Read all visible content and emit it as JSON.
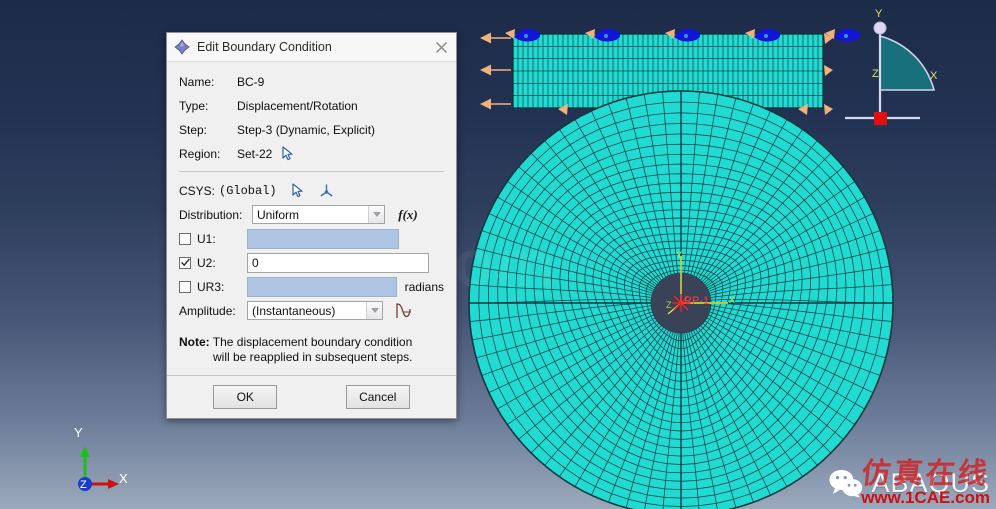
{
  "viewport": {
    "background_top_color": "#1c2b47",
    "background_bottom_color": "#9ba9bd",
    "mesh_fill_color": "#21dbd2",
    "mesh_edge_color": "#14494f",
    "bc_arrow_color": "#f0b27a",
    "bc_marker_color": "#1414d8",
    "watermark_center": "1CAE.com",
    "reference_point_label": "RP-1",
    "rp_axis_y_label": "Y",
    "rp_axis_x_label": "X",
    "rp_axis_z_label": "Z"
  },
  "triad": {
    "x_label": "X",
    "y_label": "Y",
    "z_label": "Z",
    "x_color": "#cc1111",
    "y_color": "#19c219",
    "z_color": "#1a3ccc"
  },
  "corner_triad": {
    "x_label": "X",
    "y_label": "Y",
    "z_label": "Z",
    "fill_color": "#18707c",
    "label_color": "#e3e36a"
  },
  "brand": {
    "wechat_icon": "wechat-icon",
    "name": "ABAQUS",
    "cn_watermark": "仿真在线",
    "url": "www.1CAE.com"
  },
  "dialog": {
    "title": "Edit Boundary Condition",
    "title_icon": "abaqus-diamond-icon",
    "close_icon": "close-icon",
    "fields": {
      "name_label": "Name:",
      "name_value": "BC-9",
      "type_label": "Type:",
      "type_value": "Displacement/Rotation",
      "step_label": "Step:",
      "step_value": "Step-3 (Dynamic, Explicit)",
      "region_label": "Region:",
      "region_value": "Set-22",
      "region_picker_icon": "cursor-pick-icon",
      "csys_label": "CSYS:",
      "csys_value": "(Global)",
      "csys_pick_icon": "cursor-pick-icon",
      "csys_axes_icon": "axes-triad-icon",
      "distribution_label": "Distribution:",
      "distribution_value": "Uniform",
      "distribution_fx_icon": "fx-icon",
      "u1_label": "U1:",
      "u1_checked": false,
      "u1_value": "",
      "u2_label": "U2:",
      "u2_checked": true,
      "u2_value": "0",
      "ur3_label": "UR3:",
      "ur3_checked": false,
      "ur3_value": "",
      "ur3_unit": "radians",
      "amplitude_label": "Amplitude:",
      "amplitude_value": "(Instantaneous)",
      "amplitude_icon": "amplitude-curve-icon"
    },
    "note": {
      "keyword": "Note:",
      "line1": "The displacement boundary condition",
      "line2": "will be reapplied in subsequent steps."
    },
    "buttons": {
      "ok": "OK",
      "cancel": "Cancel"
    }
  }
}
